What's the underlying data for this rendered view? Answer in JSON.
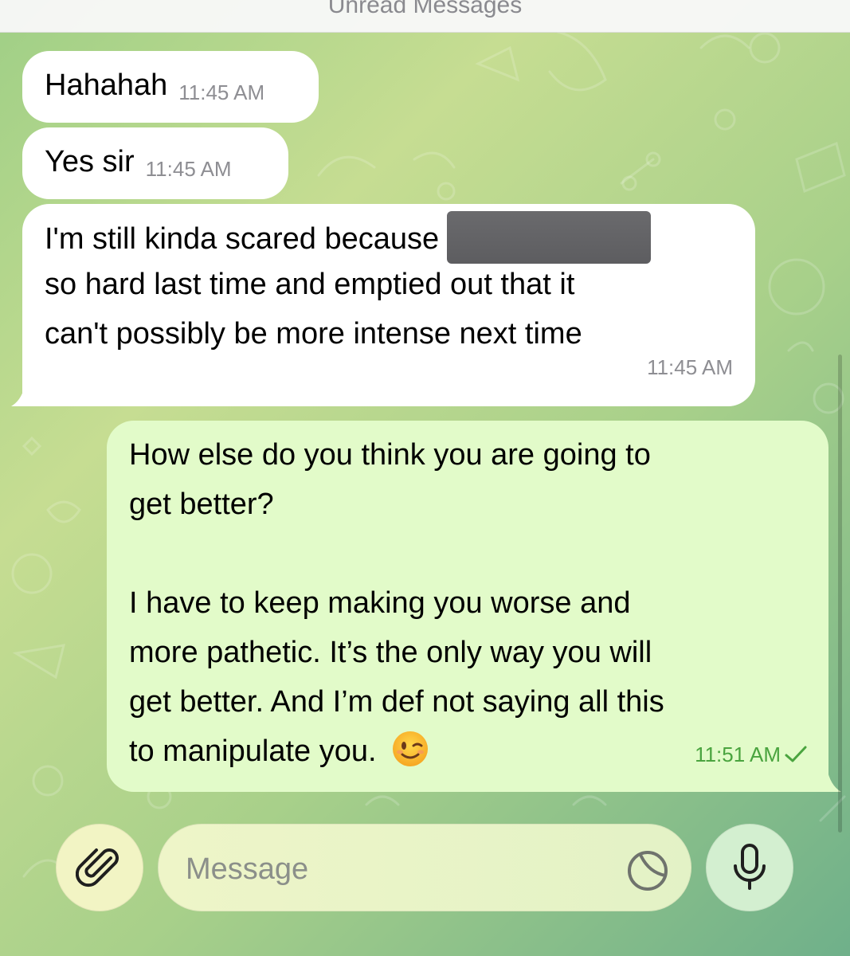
{
  "header": {
    "unread_label": "Unread Messages"
  },
  "messages": [
    {
      "direction": "incoming",
      "text": "Hahahah",
      "time": "11:45 AM"
    },
    {
      "direction": "incoming",
      "text": "Yes sir",
      "time": "11:45 AM"
    },
    {
      "direction": "incoming",
      "line1": "I'm still kinda scared because",
      "line2": "so hard last time and emptied out that it",
      "line3": "can't possibly be more intense next time",
      "time": "11:45 AM",
      "redacted": true
    },
    {
      "direction": "outgoing",
      "line1": "How else do you think you are going to",
      "line2": "get better?",
      "line3": "I have to keep making you worse and",
      "line4": "more pathetic. It’s the only way you will",
      "line5": "get better. And I’m def not saying all this",
      "line6": "to manipulate you.",
      "emoji": "winking-face",
      "time": "11:51 AM",
      "status": "sent"
    }
  ],
  "composer": {
    "placeholder": "Message",
    "value": "",
    "icons": {
      "attach": "paperclip-icon",
      "sticker": "sticker-icon",
      "voice": "microphone-icon"
    }
  },
  "colors": {
    "incoming_bubble": "#ffffff",
    "outgoing_bubble": "#e2fbc9",
    "outgoing_time": "#4aa43f",
    "time_gray": "#8e8e93"
  }
}
